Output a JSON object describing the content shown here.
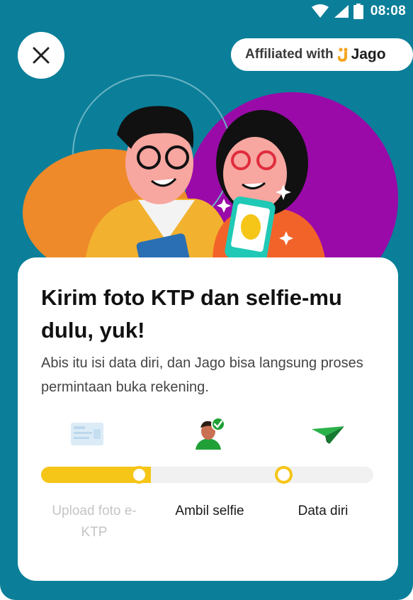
{
  "status_bar": {
    "time": "08:08",
    "icons": [
      "wifi-icon",
      "signal-icon",
      "battery-icon"
    ]
  },
  "header": {
    "close_icon": "close-icon",
    "affiliated_label": "Affiliated with",
    "brand_name": "Jago"
  },
  "illustration": {
    "name": "couple-with-phone-illustration"
  },
  "card": {
    "title": "Kirim foto KTP dan selfie-mu dulu, yuk!",
    "subtitle": "Abis itu isi data diri, dan Jago bisa langsung proses permintaan buka rekening.",
    "steps": [
      {
        "label": "Upload foto e-KTP",
        "icon": "id-card-icon",
        "state": "done"
      },
      {
        "label": "Ambil selfie",
        "icon": "selfie-person-icon",
        "state": "active"
      },
      {
        "label": "Data diri",
        "icon": "paper-plane-icon",
        "state": "pending"
      }
    ],
    "progress": 0.33
  },
  "colors": {
    "background": "#0b7f99",
    "accent": "#f5c518",
    "purple": "#9a0aa8",
    "orange": "#ee8a2a"
  }
}
